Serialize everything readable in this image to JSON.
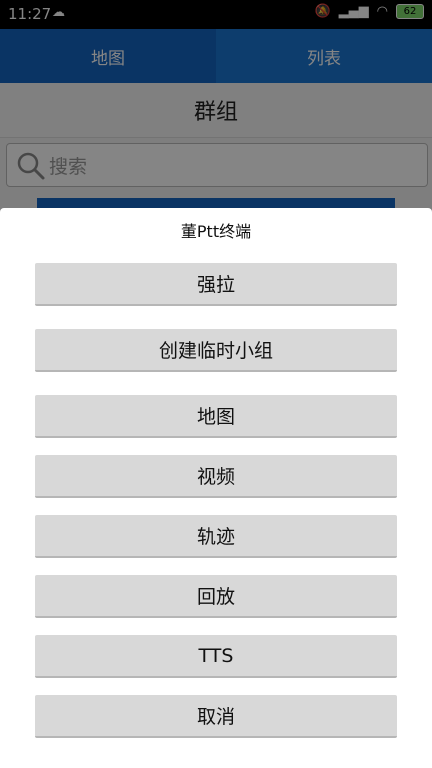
{
  "status_bar": {
    "time": "11:27",
    "battery": "62"
  },
  "tabs": [
    {
      "label": "地图"
    },
    {
      "label": "列表"
    }
  ],
  "page": {
    "title": "群组",
    "search_placeholder": "搜索"
  },
  "dialog": {
    "title": "董Ptt终端",
    "buttons": [
      {
        "label": "强拉"
      },
      {
        "label": "创建临时小组"
      },
      {
        "label": "地图"
      },
      {
        "label": "视频"
      },
      {
        "label": "轨迹"
      },
      {
        "label": "回放"
      },
      {
        "label": "TTS"
      },
      {
        "label": "取消"
      }
    ]
  }
}
